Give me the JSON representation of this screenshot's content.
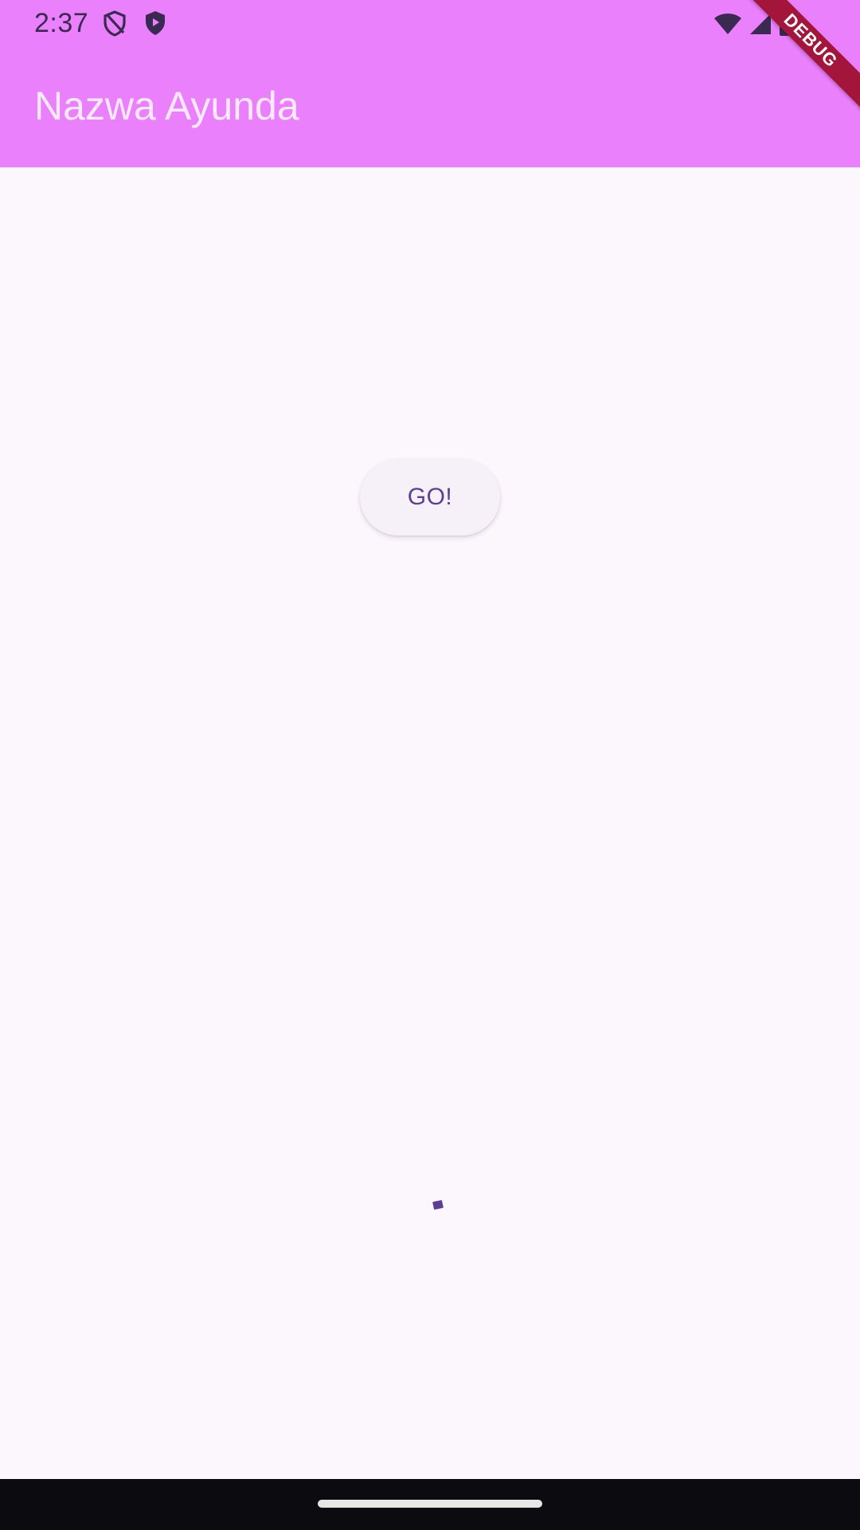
{
  "status_bar": {
    "time": "2:37",
    "left_icons": [
      "shield-off-icon",
      "play-shield-icon"
    ],
    "right_icons": [
      "wifi-icon",
      "cellular-signal-icon",
      "battery-icon"
    ],
    "background": "#ea80fc"
  },
  "app_bar": {
    "title": "Nazwa Ayunda",
    "background": "#ea80fc",
    "title_color": "#fbeaff"
  },
  "debug_banner": {
    "label": "DEBUG",
    "color": "#a3153a"
  },
  "main": {
    "go_button": {
      "label": "GO!",
      "text_color": "#5a3f94"
    },
    "progress_indicator": {
      "color": "#5a3f94"
    },
    "background": "#fcf6fd"
  },
  "navigation_bar": {
    "handle": "home-gesture-handle"
  }
}
